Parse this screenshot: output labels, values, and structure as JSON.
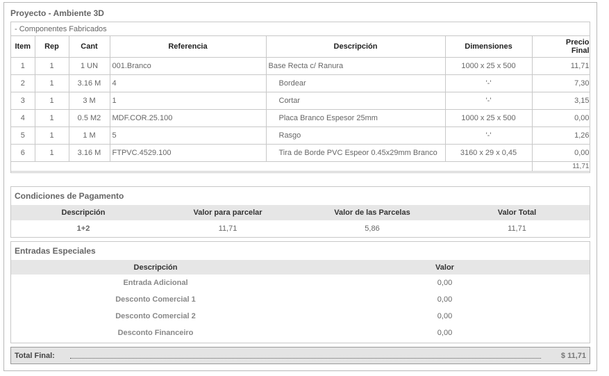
{
  "project_title": "Proyecto - Ambiente 3D",
  "components": {
    "header": "- Componentes Fabricados",
    "columns": [
      "Item",
      "Rep",
      "Cant",
      "Referencia",
      "Descripción",
      "Dimensiones",
      "Precio",
      "Final"
    ],
    "rows": [
      {
        "item": "1",
        "rep": "1",
        "cant": "1 UN",
        "ref": "001.Branco",
        "desc": "Base Recta c/ Ranura",
        "dim": "1000 x 25 x 500",
        "precio": "11,71"
      },
      {
        "item": "2",
        "rep": "1",
        "cant": "3.16 M",
        "ref": "4",
        "desc": "Bordear",
        "dim": "'-'",
        "precio": "7,30"
      },
      {
        "item": "3",
        "rep": "1",
        "cant": "3 M",
        "ref": "1",
        "desc": "Cortar",
        "dim": "'-'",
        "precio": "3,15"
      },
      {
        "item": "4",
        "rep": "1",
        "cant": "0.5 M2",
        "ref": "MDF.COR.25.100",
        "desc": "Placa Branco Espesor 25mm",
        "dim": "1000 x 25 x 500",
        "precio": "0,00"
      },
      {
        "item": "5",
        "rep": "1",
        "cant": "1 M",
        "ref": "5",
        "desc": "Rasgo",
        "dim": "'-'",
        "precio": "1,26"
      },
      {
        "item": "6",
        "rep": "1",
        "cant": "3.16 M",
        "ref": "FTPVC.4529.100",
        "desc": "Tira de Borde PVC Espeor 0.45x29mm Branco",
        "dim": "3160 x 29 x 0,45",
        "precio": "0,00"
      }
    ],
    "total": "11,71"
  },
  "payment": {
    "title": "Condiciones de Pagamento",
    "columns": [
      "Descripción",
      "Valor para parcelar",
      "Valor de las Parcelas",
      "Valor Total"
    ],
    "row": {
      "desc": "1+2",
      "parcelar": "11,71",
      "parcelas": "5,86",
      "total": "11,71"
    }
  },
  "special": {
    "title": "Entradas Especiales",
    "columns": [
      "Descripción",
      "Valor"
    ],
    "rows": [
      {
        "desc": "Entrada Adicional",
        "valor": "0,00"
      },
      {
        "desc": "Desconto Comercial 1",
        "valor": "0,00"
      },
      {
        "desc": "Desconto Comercial 2",
        "valor": "0,00"
      },
      {
        "desc": "Desconto Financeiro",
        "valor": "0,00"
      }
    ]
  },
  "final": {
    "label": "Total Final:",
    "value": "$ 11,71"
  }
}
